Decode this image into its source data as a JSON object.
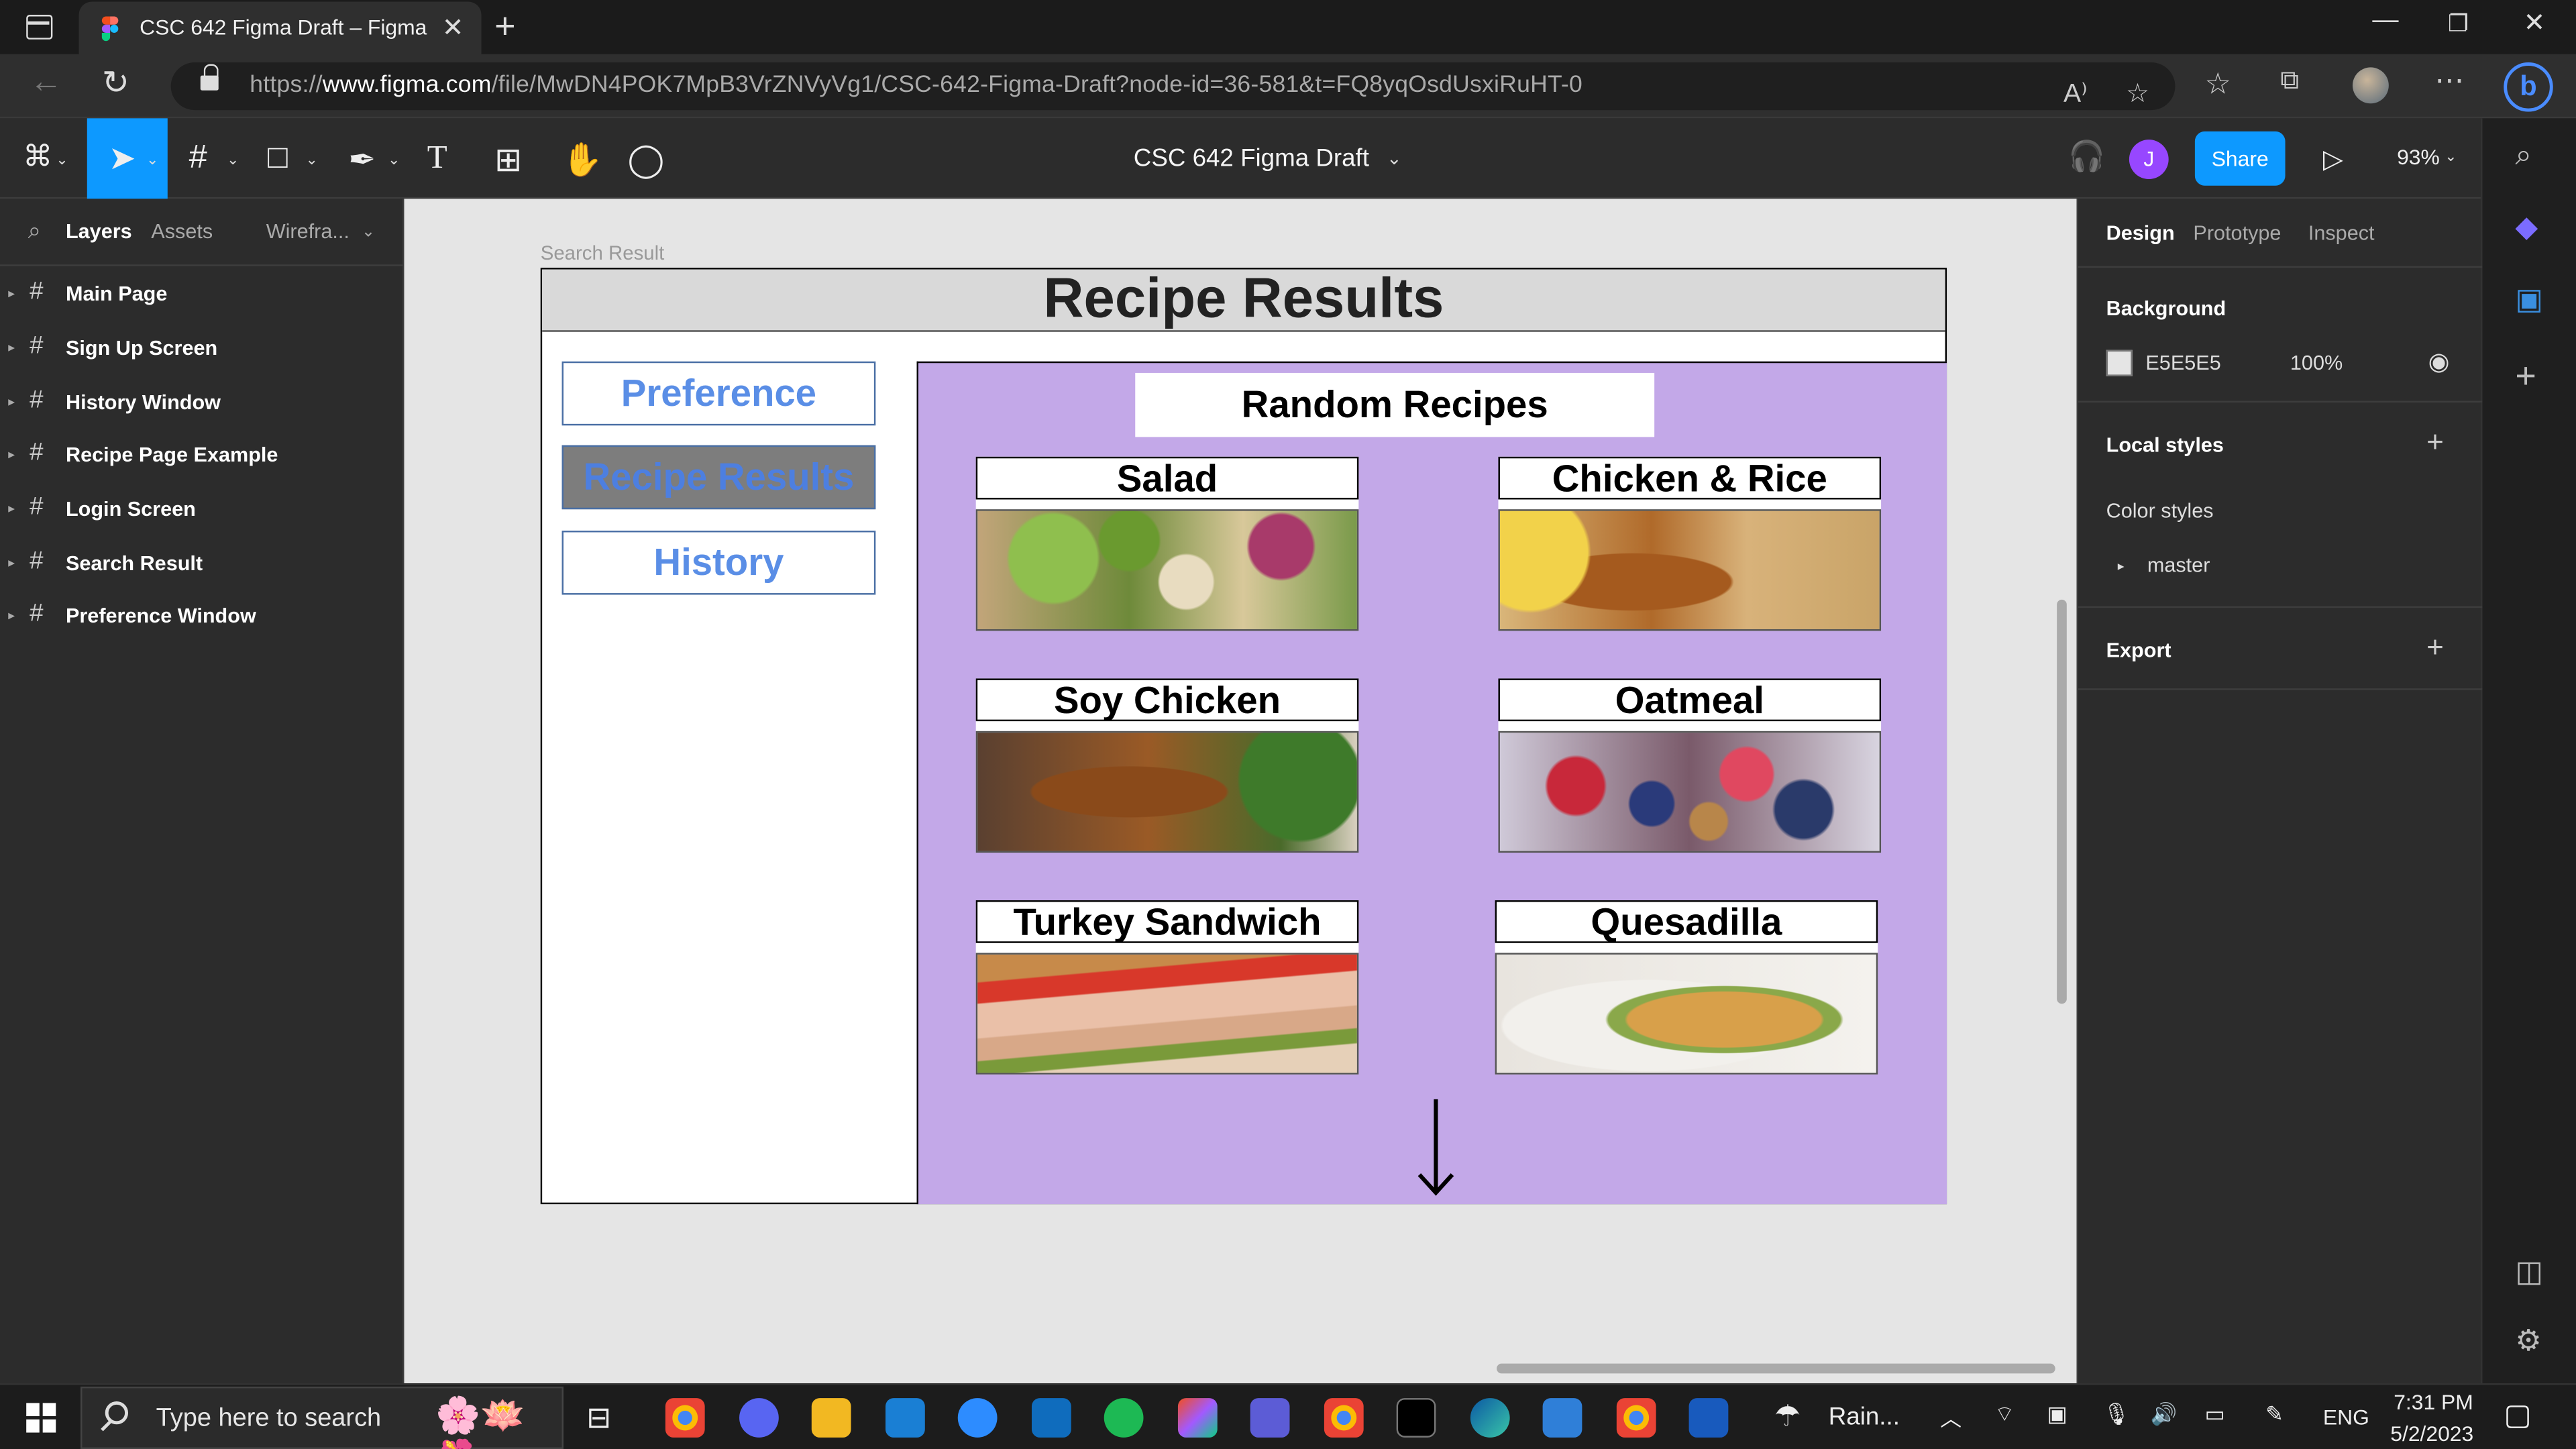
{
  "browser": {
    "tab_title": "CSC 642 Figma Draft – Figma",
    "url_prefix": "https://",
    "url_host": "www.figma.com",
    "url_path": "/file/MwDN4POK7MpB3VrZNVyVg1/CSC-642-Figma-Draft?node-id=36-581&t=FQ8yqOsdUsxiRuHT-0"
  },
  "figma_toolbar": {
    "doc_title": "CSC 642 Figma Draft",
    "avatar_initial": "J",
    "share_label": "Share",
    "zoom": "93%"
  },
  "left_panel": {
    "tabs": [
      "Layers",
      "Assets",
      "Wirefra..."
    ],
    "layers": [
      "Main Page",
      "Sign Up Screen",
      "History Window",
      "Recipe Page Example",
      "Login Screen",
      "Search Result",
      "Preference Window"
    ]
  },
  "canvas": {
    "frame_label": "Search Result",
    "frame_title": "Recipe Results",
    "nav_buttons": [
      "Preference",
      "Recipe Results",
      "History"
    ],
    "section_title": "Random Recipes",
    "recipes": [
      "Salad",
      "Chicken & Rice",
      "Soy Chicken",
      "Oatmeal",
      "Turkey Sandwich",
      "Quesadilla"
    ]
  },
  "right_panel": {
    "tabs": [
      "Design",
      "Prototype",
      "Inspect"
    ],
    "background_heading": "Background",
    "background_hex": "E5E5E5",
    "background_opacity": "100%",
    "local_styles_heading": "Local styles",
    "color_styles_label": "Color styles",
    "color_style_item": "master",
    "export_heading": "Export"
  },
  "taskbar": {
    "search_placeholder": "Type here to search",
    "weather": "Rain...",
    "language": "ENG",
    "time": "7:31 PM",
    "date": "5/2/2023"
  },
  "colors": {
    "figma_blue": "#0d99ff",
    "canvas_bg": "#e5e5e5",
    "content_purple": "#c3a8e8",
    "nav_text_blue": "#5a8ee6"
  }
}
